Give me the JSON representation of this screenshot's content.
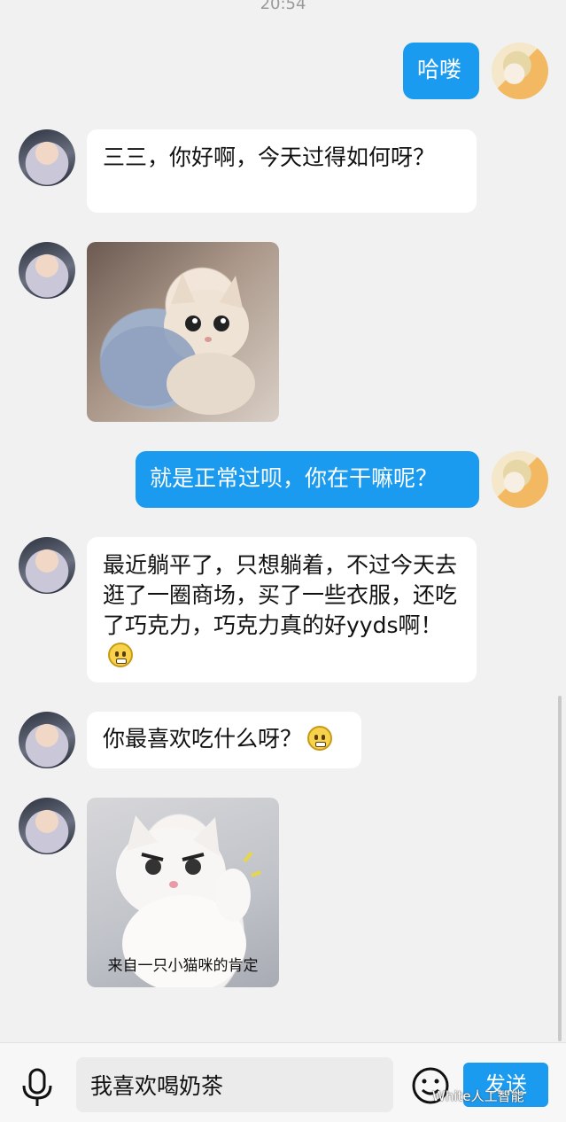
{
  "status": {
    "time": "20:54"
  },
  "messages": [
    {
      "side": "right",
      "text": "哈喽"
    },
    {
      "side": "left",
      "text": "三三，你好啊，今天过得如何呀？"
    },
    {
      "side": "left",
      "type": "image",
      "alt": "cat holding towel"
    },
    {
      "side": "right",
      "text": "就是正常过呗，你在干嘛呢？"
    },
    {
      "side": "left",
      "text": "最近躺平了，只想躺着，不过今天去逛了一圈商场，买了一些衣服，还吃了巧克力，巧克力真的好yyds啊！"
    },
    {
      "side": "left",
      "text": "你最喜欢吃什么呀？"
    },
    {
      "side": "left",
      "type": "image",
      "caption": "来自一只小猫咪的肯定"
    }
  ],
  "composer": {
    "input_value": "我喜欢喝奶茶",
    "send_label": "发送"
  },
  "watermark": "White人工智能",
  "icons": {
    "mic": "microphone-icon",
    "emoji": "smiley-icon"
  },
  "colors": {
    "accent": "#1a9bf0",
    "background": "#f1f1f1",
    "bubble_left": "#ffffff"
  }
}
